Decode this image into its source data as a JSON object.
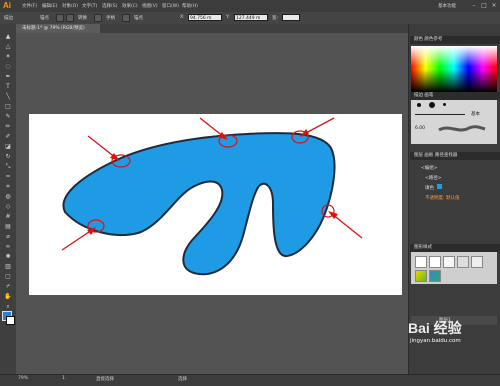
{
  "app": {
    "logo": "Ai",
    "workspace": "基本功能",
    "controls": [
      "–",
      "□",
      "×"
    ]
  },
  "menu": [
    "文件(F)",
    "编辑(E)",
    "对象(O)",
    "文字(T)",
    "选择(S)",
    "效果(C)",
    "视图(V)",
    "窗口(W)",
    "帮助(H)"
  ],
  "controlbar": {
    "mode_label": "描边",
    "fields": [
      "锚点",
      "转换",
      "手柄",
      "锚点",
      "X:",
      "Y:"
    ],
    "x_value": "94.756 m",
    "y_value": "127.449 m",
    "w_label": "宽:"
  },
  "document": {
    "tab": "未标题-1* @ 79% (RGB/预览)"
  },
  "panels": {
    "color_title": "颜色  颜色参考",
    "brush_title": "描边  画笔",
    "brush_basic": "基本",
    "brush_size": "6.00",
    "layers_title": "图层  画板  路径查找器",
    "layer_group": "<编组>",
    "layer_path": "<路径>",
    "layer_fill": "填色",
    "layer_extra": "不透明度: 默认值",
    "styles_title": "图形样式",
    "bottom_layer": "图层1"
  },
  "status": {
    "zoom": "79%",
    "page": "1",
    "tool": "直接选择",
    "info": "选择"
  },
  "watermark": {
    "brand": "Bai 经验",
    "url": "jingyan.baidu.com"
  },
  "colors": {
    "fill": "#1e9be4",
    "stroke": "#1f2a3a",
    "mark": "#e01010",
    "artboard": "#ffffff"
  }
}
